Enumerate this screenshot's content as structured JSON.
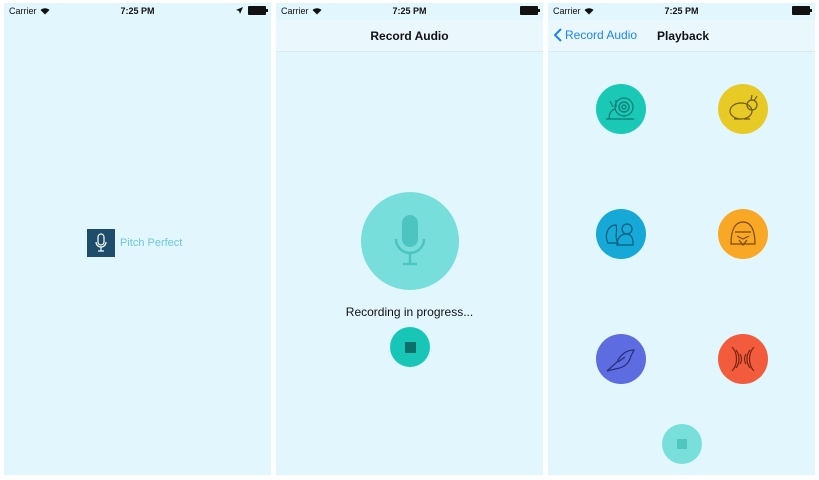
{
  "status": {
    "carrier": "Carrier",
    "time": "7:25 PM"
  },
  "screen1": {
    "app_name": "Pitch Perfect"
  },
  "screen2": {
    "title": "Record Audio",
    "recording_label": "Recording in progress..."
  },
  "screen3": {
    "back_label": "Record Audio",
    "title": "Playback"
  },
  "effects": [
    {
      "icon": "snail-icon",
      "color": "#1ac8b6"
    },
    {
      "icon": "rabbit-icon",
      "color": "#e8ca27"
    },
    {
      "icon": "chipmunk-icon",
      "color": "#16a8d6"
    },
    {
      "icon": "vader-icon",
      "color": "#f8a824"
    },
    {
      "icon": "parrot-icon",
      "color": "#5d6de1"
    },
    {
      "icon": "reverb-icon",
      "color": "#f25c3d"
    }
  ],
  "colors": {
    "background": "#e2f6fd",
    "accent": "#1a84ff"
  }
}
